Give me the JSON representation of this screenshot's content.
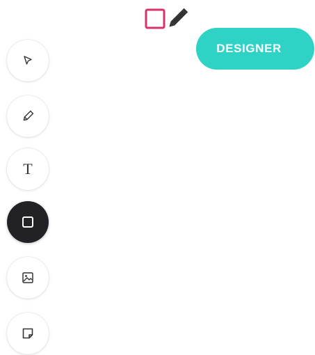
{
  "header": {
    "designer_label": "DESIGNER",
    "logo_icon": "square-pencil-logo-icon"
  },
  "colors": {
    "accent": "#2ed3c6",
    "logo_pink": "#d6336c",
    "active_tool_bg": "#222226"
  },
  "toolbar": {
    "tools": [
      {
        "name": "select",
        "icon": "cursor-arrow-icon",
        "active": false
      },
      {
        "name": "pencil",
        "icon": "pencil-icon",
        "active": false
      },
      {
        "name": "text",
        "icon": "text-icon",
        "glyph": "T",
        "active": false
      },
      {
        "name": "rectangle",
        "icon": "square-icon",
        "active": true
      },
      {
        "name": "image",
        "icon": "image-icon",
        "active": false
      },
      {
        "name": "sticky-note",
        "icon": "sticky-note-icon",
        "active": false
      }
    ]
  }
}
